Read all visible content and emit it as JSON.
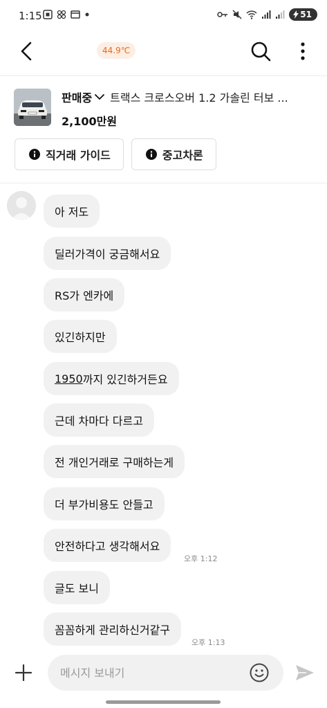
{
  "status_bar": {
    "time": "1:15",
    "battery": "51"
  },
  "header": {
    "temperature": "44.9℃"
  },
  "product": {
    "status": "판매중",
    "title": "트랙스 크로스오버 1.2 가솔린 터보 ...",
    "price": "2,100만원"
  },
  "chips": {
    "guide": "직거래 가이드",
    "used_car": "중고차론"
  },
  "messages": [
    {
      "text": "아 저도"
    },
    {
      "text": "딜러가격이 궁금해서요"
    },
    {
      "text": "RS가 엔카에"
    },
    {
      "text": "있긴하지만"
    },
    {
      "prefix": "1950",
      "text": "까지 있긴하거든요"
    },
    {
      "text": "근데 차마다 다르고"
    },
    {
      "text": "전 개인거래로 구매하는게"
    },
    {
      "text": "더 부가비용도 안들고"
    },
    {
      "text": "안전하다고 생각해서요",
      "time": "오후 1:12"
    },
    {
      "text": "글도 보니"
    },
    {
      "text": "꼼꼼하게 관리하신거같구",
      "time": "오후 1:13"
    }
  ],
  "composer": {
    "placeholder": "메시지 보내기"
  },
  "colors": {
    "accent": "#e86a17",
    "bubble": "#f1f1f1"
  }
}
